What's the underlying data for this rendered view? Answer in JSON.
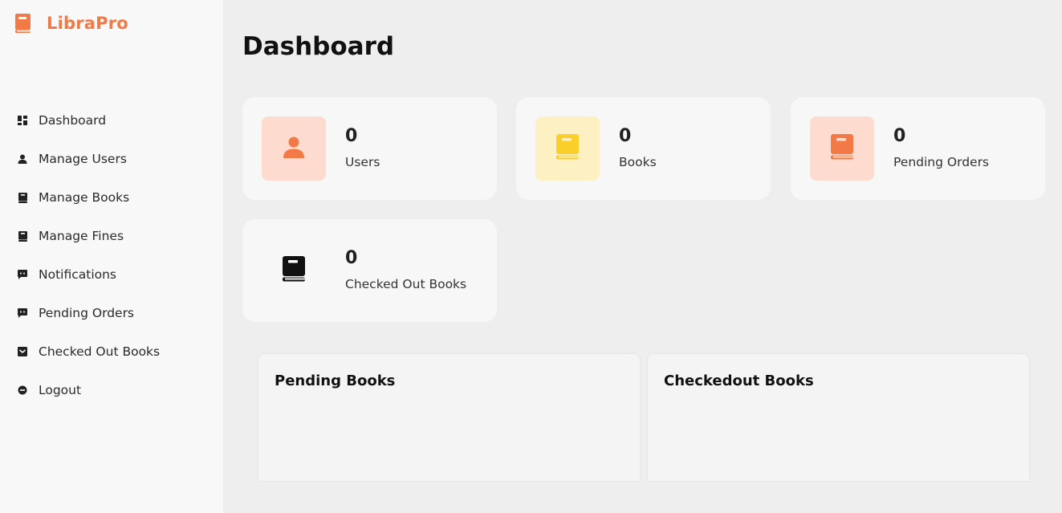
{
  "brand": {
    "name": "LibraPro",
    "color": "#f27a46"
  },
  "sidebar": {
    "items": [
      {
        "label": "Dashboard",
        "icon": "dashboard-grid-icon"
      },
      {
        "label": "Manage Users",
        "icon": "user-icon"
      },
      {
        "label": "Manage Books",
        "icon": "book-icon"
      },
      {
        "label": "Manage Fines",
        "icon": "book-icon"
      },
      {
        "label": "Notifications",
        "icon": "message-icon"
      },
      {
        "label": "Pending Orders",
        "icon": "message-icon"
      },
      {
        "label": "Checked Out Books",
        "icon": "inbox-icon"
      },
      {
        "label": "Logout",
        "icon": "logout-icon"
      }
    ]
  },
  "main": {
    "title": "Dashboard",
    "cards": [
      {
        "count": "0",
        "label": "Users",
        "icon": "user-icon",
        "icon_bg": "#fddccf",
        "icon_color": "#f27a46"
      },
      {
        "count": "0",
        "label": "Books",
        "icon": "book-icon",
        "icon_bg": "#fdf1c4",
        "icon_color": "#fbcf2a"
      },
      {
        "count": "0",
        "label": "Pending Orders",
        "icon": "book-icon",
        "icon_bg": "#fddccf",
        "icon_color": "#f27a46"
      },
      {
        "count": "0",
        "label": "Checked Out Books",
        "icon": "book-icon",
        "icon_bg": "#f7f7f7",
        "icon_color": "#111111"
      }
    ],
    "panels": [
      {
        "title": "Pending Books"
      },
      {
        "title": "Checkedout Books"
      }
    ]
  }
}
